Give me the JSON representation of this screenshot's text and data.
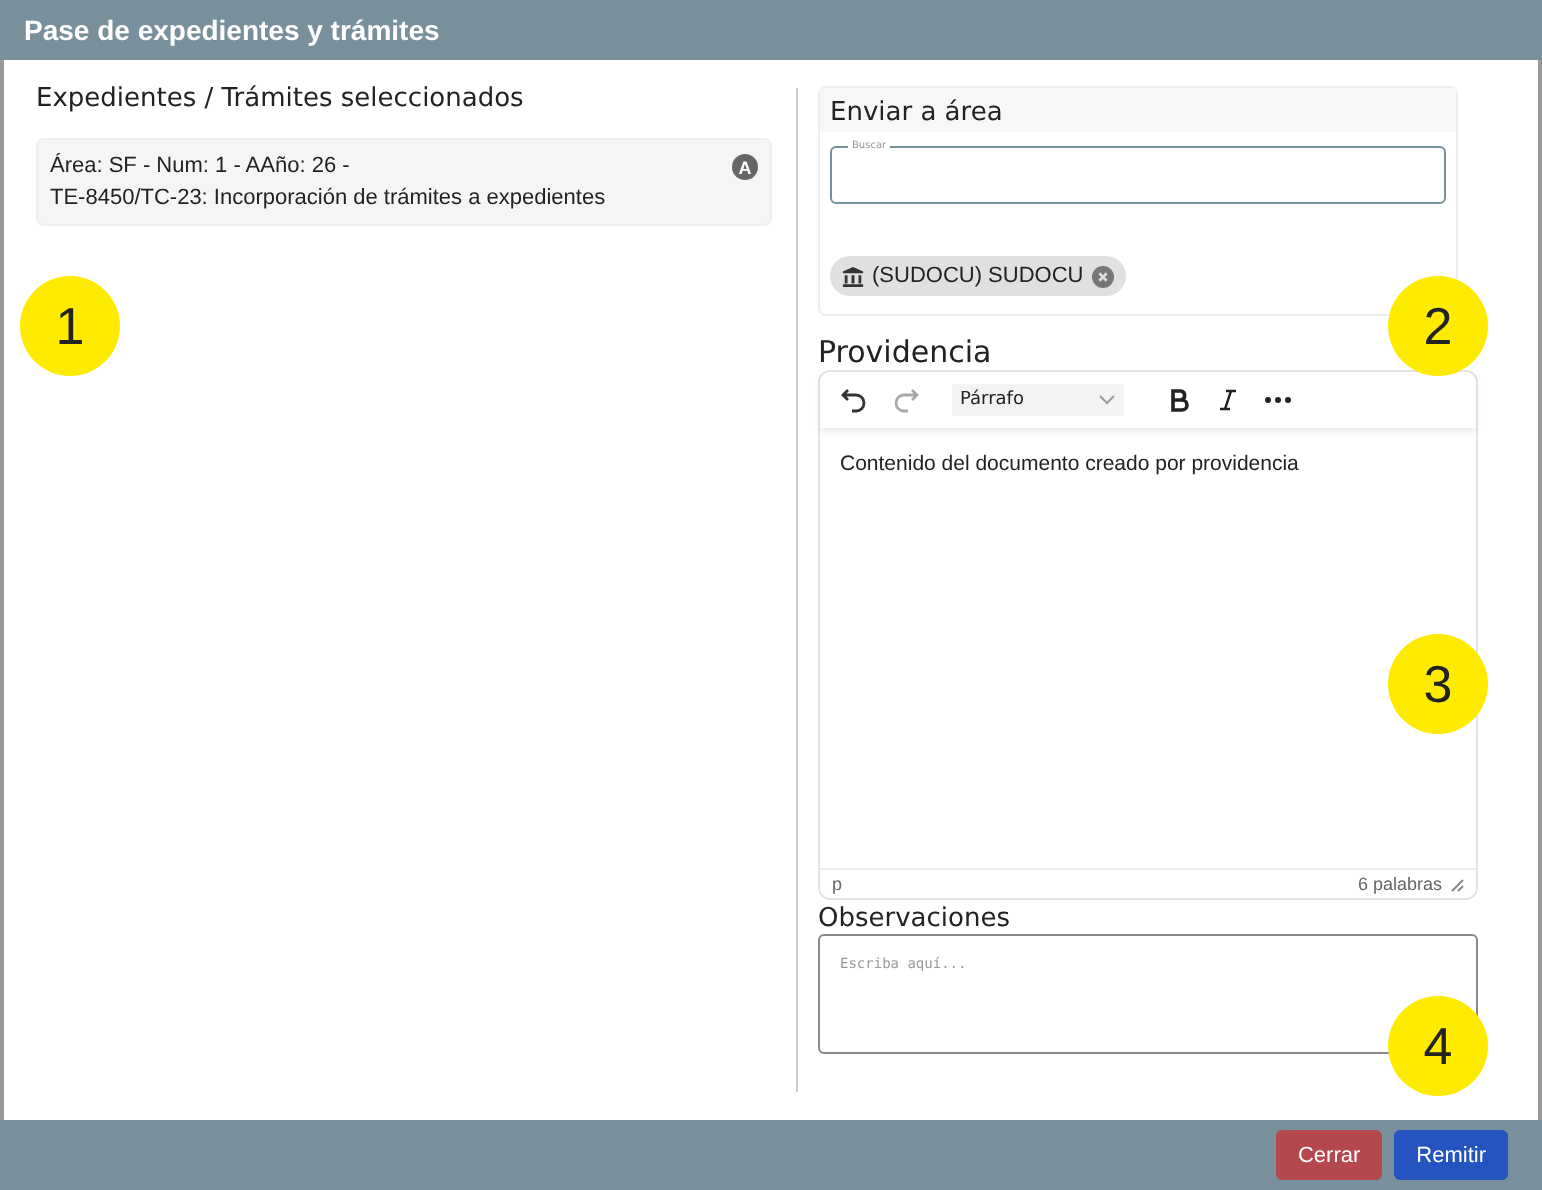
{
  "window": {
    "title": "Pase de expedientes y trámites"
  },
  "left": {
    "heading": "Expedientes / Trámites seleccionados",
    "items": [
      {
        "line1": "Área: SF - Num: 1 - AAño: 26 -",
        "line2": "TE-8450/TC-23: Incorporación de trámites a expedientes",
        "badge": "A"
      }
    ]
  },
  "send": {
    "heading": "Enviar a área",
    "search": {
      "label": "Buscar"
    },
    "chips": [
      {
        "label": "(SUDOCU) SUDOCU"
      }
    ]
  },
  "providencia": {
    "heading": "Providencia",
    "format": "Párrafo",
    "content": "Contenido del documento creado por providencia",
    "path": "p",
    "word_count": "6 palabras"
  },
  "observaciones": {
    "heading": "Observaciones",
    "placeholder": "Escriba aquí..."
  },
  "callouts": [
    "1",
    "2",
    "3",
    "4"
  ],
  "buttons": [
    {
      "label": "Cerrar",
      "kind": "danger"
    },
    {
      "label": "Remitir",
      "kind": "primary"
    }
  ]
}
